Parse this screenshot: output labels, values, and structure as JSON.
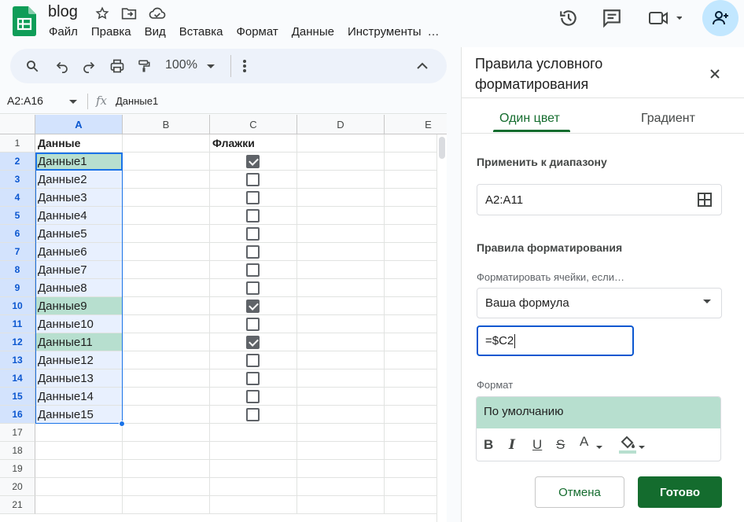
{
  "doc": {
    "title": "blog"
  },
  "menu": [
    "Файл",
    "Правка",
    "Вид",
    "Вставка",
    "Формат",
    "Данные",
    "Инструменты",
    "…"
  ],
  "toolbar": {
    "zoom": "100%"
  },
  "formula_bar": {
    "name_box": "A2:A16",
    "fx": "fx",
    "content": "Данные1"
  },
  "columns": [
    "A",
    "B",
    "C",
    "D",
    "E"
  ],
  "rows": [
    "1",
    "2",
    "3",
    "4",
    "5",
    "6",
    "7",
    "8",
    "9",
    "10",
    "11",
    "12",
    "13",
    "14",
    "15",
    "16",
    "17",
    "18",
    "19",
    "20",
    "21"
  ],
  "sheet": {
    "a1": "Данные",
    "c1": "Флажки",
    "data": [
      "Данные1",
      "Данные2",
      "Данные3",
      "Данные4",
      "Данные5",
      "Данные6",
      "Данные7",
      "Данные8",
      "Данные9",
      "Данные10",
      "Данные11",
      "Данные12",
      "Данные13",
      "Данные14",
      "Данные15"
    ],
    "checked": [
      true,
      false,
      false,
      false,
      false,
      false,
      false,
      false,
      true,
      false,
      true,
      false,
      false,
      false,
      false
    ]
  },
  "panel": {
    "title": "Правила условного форматирования",
    "tab_single": "Один цвет",
    "tab_gradient": "Градиент",
    "apply_label": "Применить к диапазону",
    "range": "A2:A11",
    "rules_label": "Правила форматирования",
    "condition_label": "Форматировать ячейки, если…",
    "condition": "Ваша формула",
    "formula": "=$C2",
    "format_label": "Формат",
    "preview": "По умолчанию",
    "cancel": "Отмена",
    "done": "Готово"
  },
  "colors": {
    "accent": "#146c2e",
    "highlight": "#b7dfcf",
    "selection": "#e8f0fe",
    "select_border": "#1a73e8"
  }
}
